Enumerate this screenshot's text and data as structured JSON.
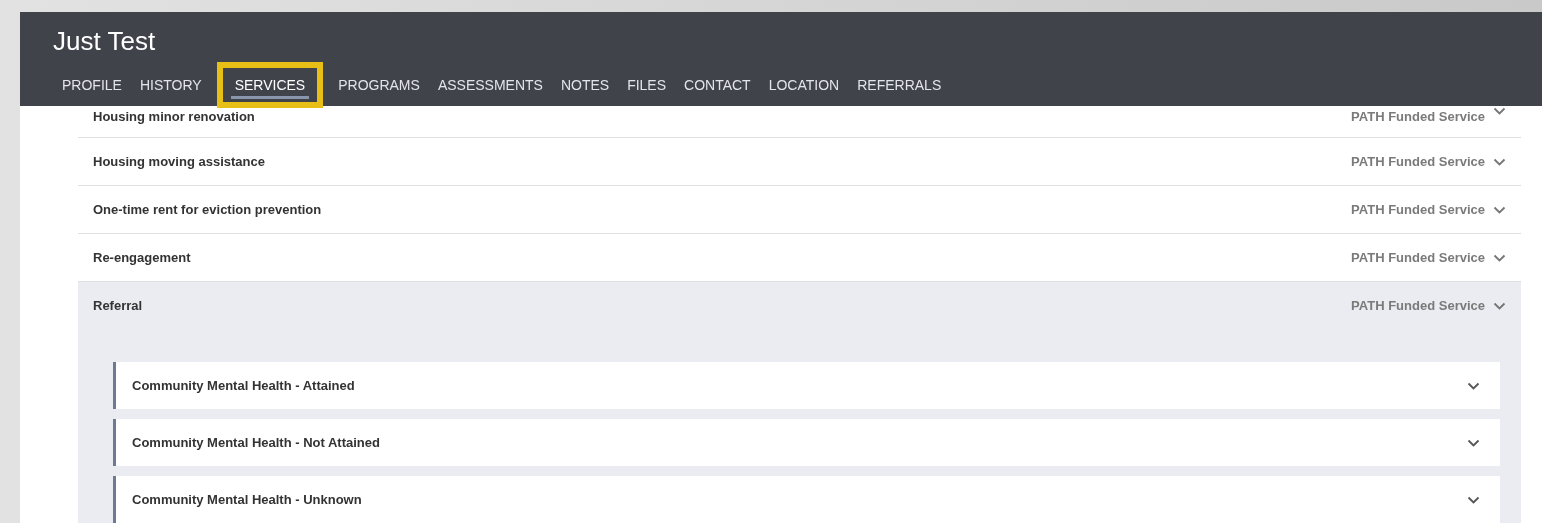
{
  "client": {
    "name": "Just Test"
  },
  "tabs": [
    {
      "label": "PROFILE",
      "selected": false
    },
    {
      "label": "HISTORY",
      "selected": false
    },
    {
      "label": "SERVICES",
      "selected": true
    },
    {
      "label": "PROGRAMS",
      "selected": false
    },
    {
      "label": "ASSESSMENTS",
      "selected": false
    },
    {
      "label": "NOTES",
      "selected": false
    },
    {
      "label": "FILES",
      "selected": false
    },
    {
      "label": "CONTACT",
      "selected": false
    },
    {
      "label": "LOCATION",
      "selected": false
    },
    {
      "label": "REFERRALS",
      "selected": false
    }
  ],
  "services": [
    {
      "name": "Housing minor renovation",
      "funding": "PATH Funded Service",
      "expanded": false
    },
    {
      "name": "Housing moving assistance",
      "funding": "PATH Funded Service",
      "expanded": false
    },
    {
      "name": "One-time rent for eviction prevention",
      "funding": "PATH Funded Service",
      "expanded": false
    },
    {
      "name": "Re-engagement",
      "funding": "PATH Funded Service",
      "expanded": false
    },
    {
      "name": "Referral",
      "funding": "PATH Funded Service",
      "expanded": true,
      "children": [
        {
          "name": "Community Mental Health - Attained"
        },
        {
          "name": "Community Mental Health - Not Attained"
        },
        {
          "name": "Community Mental Health - Unknown"
        }
      ]
    }
  ]
}
